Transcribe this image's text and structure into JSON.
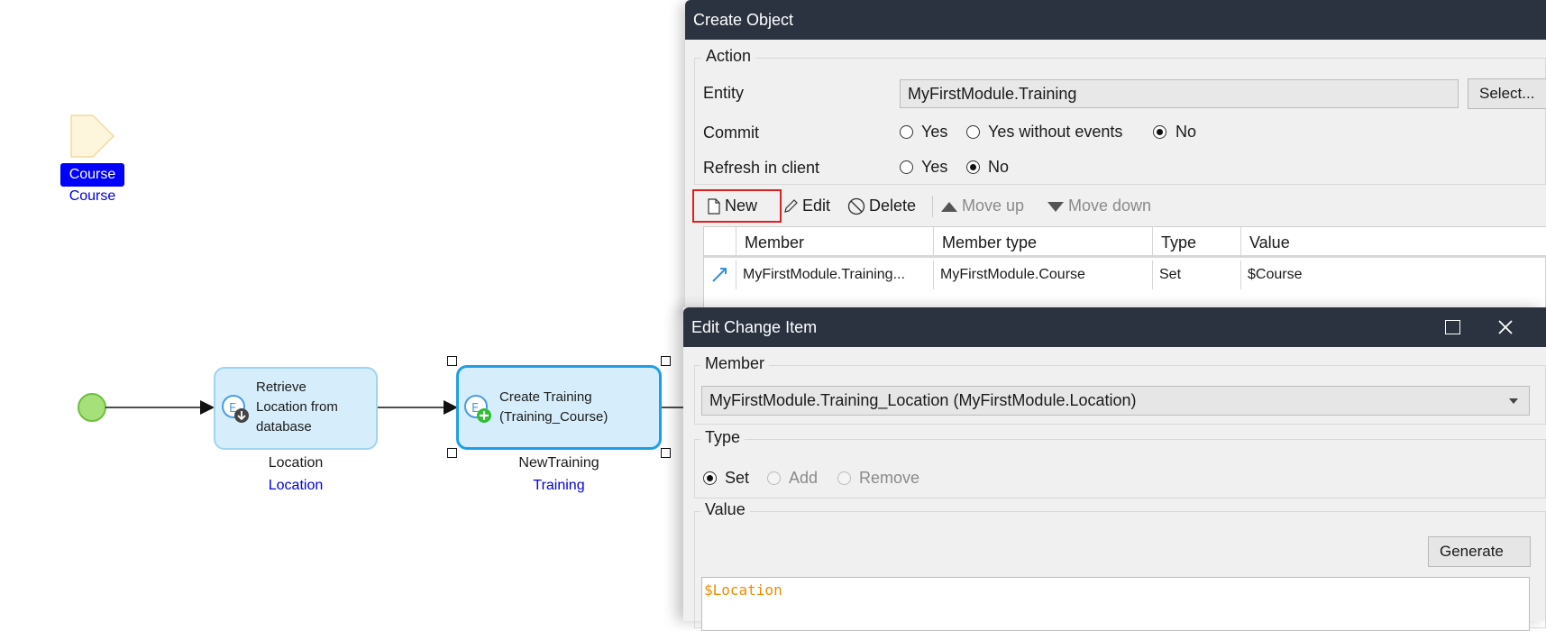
{
  "canvas": {
    "parameter": {
      "label": "Course",
      "type": "Course"
    },
    "activities": [
      {
        "text_lines": [
          "Retrieve",
          "Location from",
          "database"
        ],
        "variable": "Location",
        "type": "Location",
        "icon": "retrieve-icon"
      },
      {
        "text_lines": [
          "Create Training",
          "(Training_Course)"
        ],
        "variable": "NewTraining",
        "type": "Training",
        "icon": "create-object-icon"
      }
    ]
  },
  "create_object": {
    "title": "Create Object",
    "action_group": "Action",
    "entity_label": "Entity",
    "entity_value": "MyFirstModule.Training",
    "select_button": "Select...",
    "commit_label": "Commit",
    "commit_options": [
      "Yes",
      "Yes without events",
      "No"
    ],
    "commit_selected": "No",
    "refresh_label": "Refresh in client",
    "refresh_options": [
      "Yes",
      "No"
    ],
    "refresh_selected": "No",
    "toolbar": {
      "new": "New",
      "edit": "Edit",
      "delete": "Delete",
      "move_up": "Move up",
      "move_down": "Move down"
    },
    "columns": [
      "Member",
      "Member type",
      "Type",
      "Value"
    ],
    "rows": [
      {
        "member": "MyFirstModule.Training...",
        "member_type": "MyFirstModule.Course",
        "type": "Set",
        "value": "$Course"
      }
    ],
    "highlight_color": "#e02020"
  },
  "edit_change_item": {
    "title": "Edit Change Item",
    "member_group": "Member",
    "member_value": "MyFirstModule.Training_Location (MyFirstModule.Location)",
    "type_group": "Type",
    "type_options": [
      "Set",
      "Add",
      "Remove"
    ],
    "type_selected": "Set",
    "value_group": "Value",
    "generate_button": "Generate",
    "expression": "$Location"
  },
  "colors": {
    "titlebar": "#2b3340",
    "dialog_bg": "#f0f0f0",
    "activity_fill": "#d6eefb",
    "activity_border": "#1d9fe5",
    "start_event": "#a6e07a",
    "link_blue": "#0000dd",
    "expression_orange": "#f08c00"
  }
}
